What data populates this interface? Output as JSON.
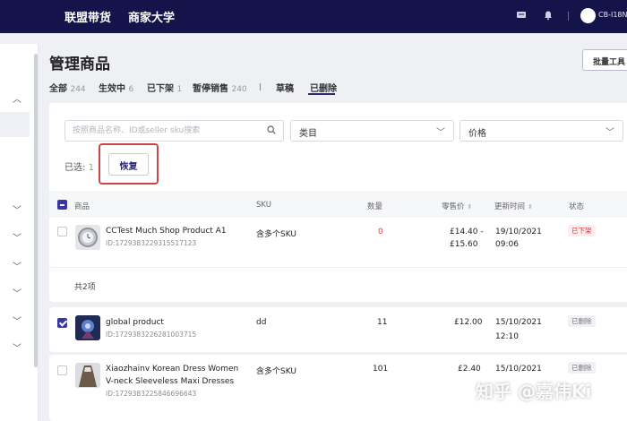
{
  "topbar": {
    "nav": [
      "联盟带货",
      "商家大学"
    ],
    "icons": [
      "message-icon",
      "bell-icon"
    ],
    "user": "CB-I18N"
  },
  "page": {
    "title": "管理商品",
    "batch_tool": "批量工具"
  },
  "tabs": [
    {
      "label": "全部",
      "count": "244"
    },
    {
      "label": "生效中",
      "count": "6"
    },
    {
      "label": "已下架",
      "count": "1"
    },
    {
      "label": "暂停销售",
      "count": "240"
    },
    {
      "label": "草稿",
      "count": ""
    },
    {
      "label": "已删除",
      "count": ""
    }
  ],
  "filters": {
    "search_placeholder": "按照商品名称、ID或seller sku搜索",
    "category": "类目",
    "price": "价格"
  },
  "selection": {
    "label": "已选:",
    "count": "1",
    "restore": "恢复"
  },
  "table": {
    "headers": {
      "product": "商品",
      "sku": "SKU",
      "qty": "数量",
      "price": "零售价",
      "updated": "更新时间",
      "status": "状态"
    },
    "rows": [
      {
        "name": "CCTest Much Shop Product A1",
        "id": "ID:1729383229315517123",
        "sku": "含多个SKU",
        "qty": "0",
        "price_line1": "£14.40 -",
        "price_line2": "£15.60",
        "date": "19/10/2021",
        "time": "09:06",
        "status": "已下架"
      },
      {
        "name": "global product",
        "id": "ID:1729383226281003715",
        "sku": "dd",
        "qty": "11",
        "price_line1": "£12.00",
        "price_line2": "",
        "date": "15/10/2021",
        "time": "12:10",
        "status": "已删除"
      },
      {
        "name": "Xiaozhainv Korean Dress Women",
        "name2": "V-neck Sleeveless Maxi Dresses",
        "id": "ID:1729383225846696643",
        "sku": "含多个SKU",
        "qty": "101",
        "price_line1": "£2.40",
        "price_line2": "",
        "date": "15/10/2021",
        "time": "",
        "status": "已删除"
      }
    ],
    "total": "共2项"
  },
  "watermark": "知乎 @嘉伟Ki",
  "colors": {
    "topbar": "#14134a",
    "accent": "#3a37a0",
    "highlight_box": "#c9474b",
    "zero_qty": "#e0443a"
  }
}
